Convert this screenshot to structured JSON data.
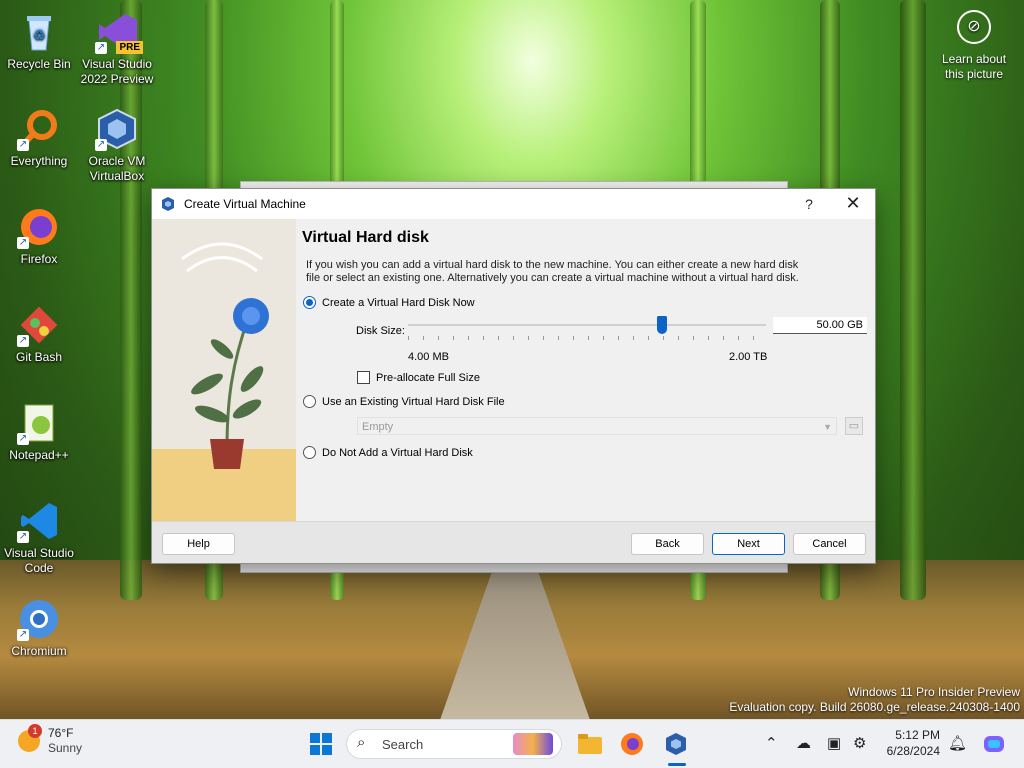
{
  "desktop": {
    "icons": [
      {
        "label": "Recycle Bin"
      },
      {
        "label": "Visual Studio 2022 Preview",
        "badge": "PRE"
      },
      {
        "label": "Everything"
      },
      {
        "label": "Oracle VM VirtualBox"
      },
      {
        "label": "Firefox"
      },
      {
        "label": "Git Bash"
      },
      {
        "label": "Notepad++"
      },
      {
        "label": "Visual Studio Code"
      },
      {
        "label": "Chromium"
      }
    ],
    "learn_about": "Learn about this picture",
    "watermark_line1": "Windows 11 Pro Insider Preview",
    "watermark_line2": "Evaluation copy. Build 26080.ge_release.240308-1400"
  },
  "dialog": {
    "title": "Create Virtual Machine",
    "help_glyph": "?",
    "close_glyph": "✕",
    "heading": "Virtual Hard disk",
    "description": "If you wish you can add a virtual hard disk to the new machine. You can either create a new hard disk file or select an existing one. Alternatively you can create a virtual machine without a virtual hard disk.",
    "options": [
      {
        "label": "Create a Virtual Hard Disk Now",
        "selected": true
      },
      {
        "label": "Use an Existing Virtual Hard Disk File",
        "selected": false
      },
      {
        "label": "Do Not Add a Virtual Hard Disk",
        "selected": false
      }
    ],
    "disk_size_label": "Disk Size:",
    "disk_size_value": "50.00 GB",
    "slider_min": "4.00 MB",
    "slider_max": "2.00 TB",
    "slider_fraction": 0.71,
    "preallocate_label": "Pre-allocate Full Size",
    "preallocate_checked": false,
    "existing_combo_value": "Empty",
    "buttons": {
      "help": "Help",
      "back": "Back",
      "next": "Next",
      "cancel": "Cancel"
    }
  },
  "taskbar": {
    "weather_temp": "76°F",
    "weather_desc": "Sunny",
    "weather_badge": "1",
    "search_placeholder": "Search",
    "time": "5:12 PM",
    "date": "6/28/2024"
  },
  "colors": {
    "accent": "#0a64c8",
    "dialog_bg": "#f0f0f0",
    "taskbar_bg": "#eef0f4"
  }
}
